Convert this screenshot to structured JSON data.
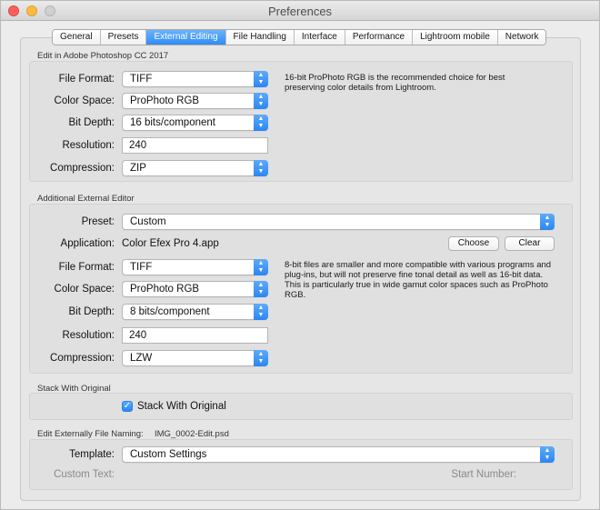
{
  "window": {
    "title": "Preferences"
  },
  "tabs": [
    {
      "label": "General"
    },
    {
      "label": "Presets"
    },
    {
      "label": "External Editing",
      "active": true
    },
    {
      "label": "File Handling"
    },
    {
      "label": "Interface"
    },
    {
      "label": "Performance"
    },
    {
      "label": "Lightroom mobile"
    },
    {
      "label": "Network"
    }
  ],
  "photoshop": {
    "section_title": "Edit in Adobe Photoshop CC 2017",
    "file_format": {
      "label": "File Format:",
      "value": "TIFF"
    },
    "color_space": {
      "label": "Color Space:",
      "value": "ProPhoto RGB"
    },
    "bit_depth": {
      "label": "Bit Depth:",
      "value": "16 bits/component"
    },
    "resolution": {
      "label": "Resolution:",
      "value": "240"
    },
    "compression": {
      "label": "Compression:",
      "value": "ZIP"
    },
    "description": "16-bit ProPhoto RGB is the recommended choice for best preserving color details from Lightroom."
  },
  "additional": {
    "section_title": "Additional External Editor",
    "preset": {
      "label": "Preset:",
      "value": "Custom"
    },
    "application": {
      "label": "Application:",
      "value": "Color Efex Pro 4.app"
    },
    "choose_label": "Choose",
    "clear_label": "Clear",
    "file_format": {
      "label": "File Format:",
      "value": "TIFF"
    },
    "color_space": {
      "label": "Color Space:",
      "value": "ProPhoto RGB"
    },
    "bit_depth": {
      "label": "Bit Depth:",
      "value": "8 bits/component"
    },
    "resolution": {
      "label": "Resolution:",
      "value": "240"
    },
    "compression": {
      "label": "Compression:",
      "value": "LZW"
    },
    "description": "8-bit files are smaller and more compatible with various programs and plug-ins, but will not preserve fine tonal detail as well as 16-bit data. This is particularly true in wide gamut color spaces such as ProPhoto RGB."
  },
  "stack": {
    "section_title": "Stack With Original",
    "checkbox_label": "Stack With Original",
    "checked": true
  },
  "naming": {
    "section_title": "Edit Externally File Naming:",
    "example": "IMG_0002-Edit.psd",
    "template": {
      "label": "Template:",
      "value": "Custom Settings"
    },
    "custom_text_label": "Custom Text:",
    "start_number_label": "Start Number:"
  },
  "colors": {
    "accent": "#2f8cf5",
    "window_bg": "#ececec",
    "group_bg": "#e0e0e0"
  },
  "icons": {
    "popup_arrow": "chevron-updown-icon",
    "checkmark": "checkmark-icon"
  }
}
